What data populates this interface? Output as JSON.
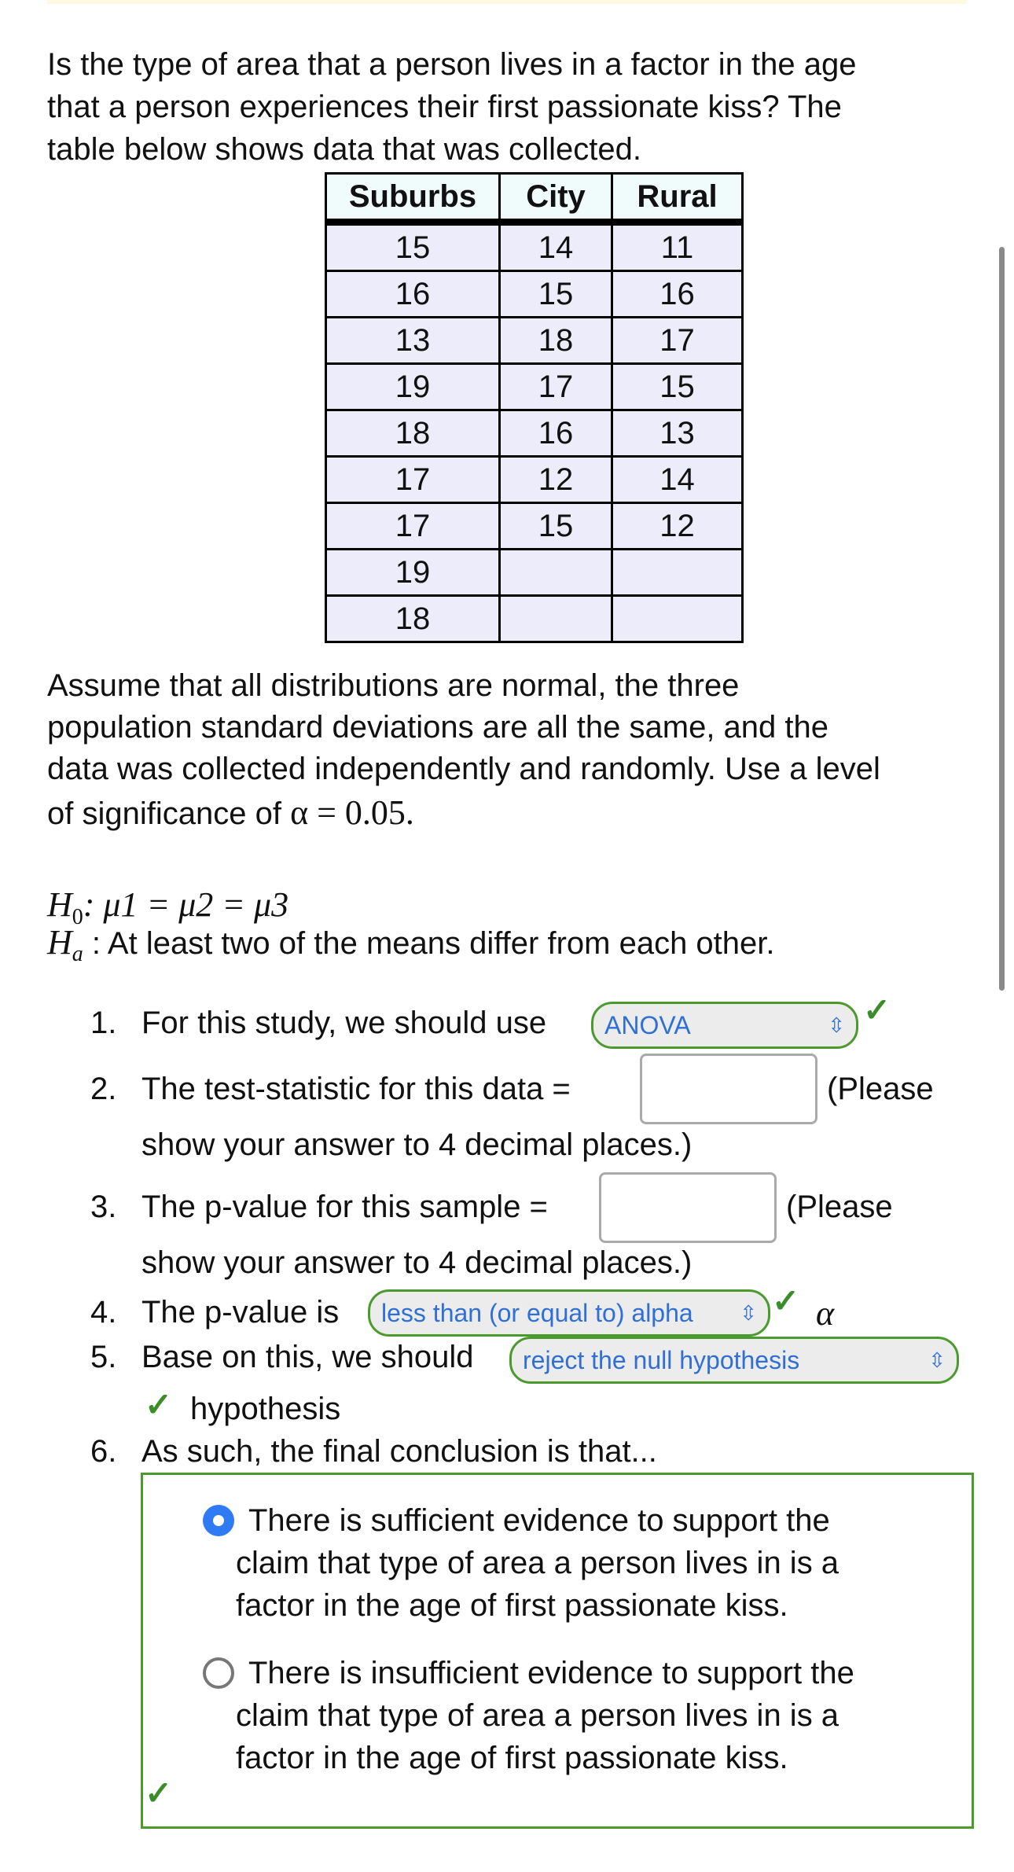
{
  "question": {
    "lines": [
      "Is the type of area that a person lives in a factor in the age",
      "that a person experiences their first passionate kiss? The",
      "table below shows data that was collected."
    ]
  },
  "table": {
    "headers": [
      "Suburbs",
      "City",
      "Rural"
    ],
    "rows": [
      [
        "15",
        "14",
        "11"
      ],
      [
        "16",
        "15",
        "16"
      ],
      [
        "13",
        "18",
        "17"
      ],
      [
        "19",
        "17",
        "15"
      ],
      [
        "18",
        "16",
        "13"
      ],
      [
        "17",
        "12",
        "14"
      ],
      [
        "17",
        "15",
        "12"
      ],
      [
        "19",
        "",
        ""
      ],
      [
        "18",
        "",
        ""
      ]
    ]
  },
  "assumptions": {
    "lines": [
      "Assume that all distributions are normal, the three",
      "population standard deviations are all the same, and the",
      "data was collected independently and randomly. Use a level",
      "of significance of "
    ],
    "alpha_expr": "α = 0.05."
  },
  "hypotheses": {
    "h0_label": "H",
    "h0_sub": "0",
    "h0_expr": ":  μ1 = μ2 = μ3",
    "ha_label": "H",
    "ha_sub": "a",
    "ha_text": " : At least two of the means differ from each other."
  },
  "items": {
    "n1": "1.",
    "t1": "For this study, we should use",
    "s1": "ANOVA",
    "n2": "2.",
    "t2": "The test-statistic for this data =",
    "t2b": "(Please",
    "t2c": "show your answer to 4 decimal places.)",
    "v2": "",
    "n3": "3.",
    "t3": "The p-value for this sample =",
    "t3b": "(Please",
    "t3c": "show your answer to 4 decimal places.)",
    "v3": "",
    "n4": "4.",
    "t4": "The p-value is",
    "s4": "less than (or equal to) alpha",
    "t4b": "α",
    "n5": "5.",
    "t5": "Base on this, we should",
    "s5": "reject the null hypothesis",
    "t5b": "hypothesis",
    "n6": "6.",
    "t6": "As such, the final conclusion is that..."
  },
  "conclusion": {
    "selected": 0,
    "options": [
      [
        "There is sufficient evidence to support the",
        "claim that type of area a person lives in is a",
        "factor in the age of first passionate kiss."
      ],
      [
        "There is insufficient evidence to support the",
        "claim that type of area a person lives in is a",
        "factor in the age of first passionate kiss."
      ]
    ]
  },
  "icons": {
    "check": "✓",
    "select_arrows": "⌃⌄"
  },
  "colors": {
    "correct": "#4a9a2e",
    "select_text": "#2f6fd6",
    "radio_selected": "#2f7bf5"
  }
}
